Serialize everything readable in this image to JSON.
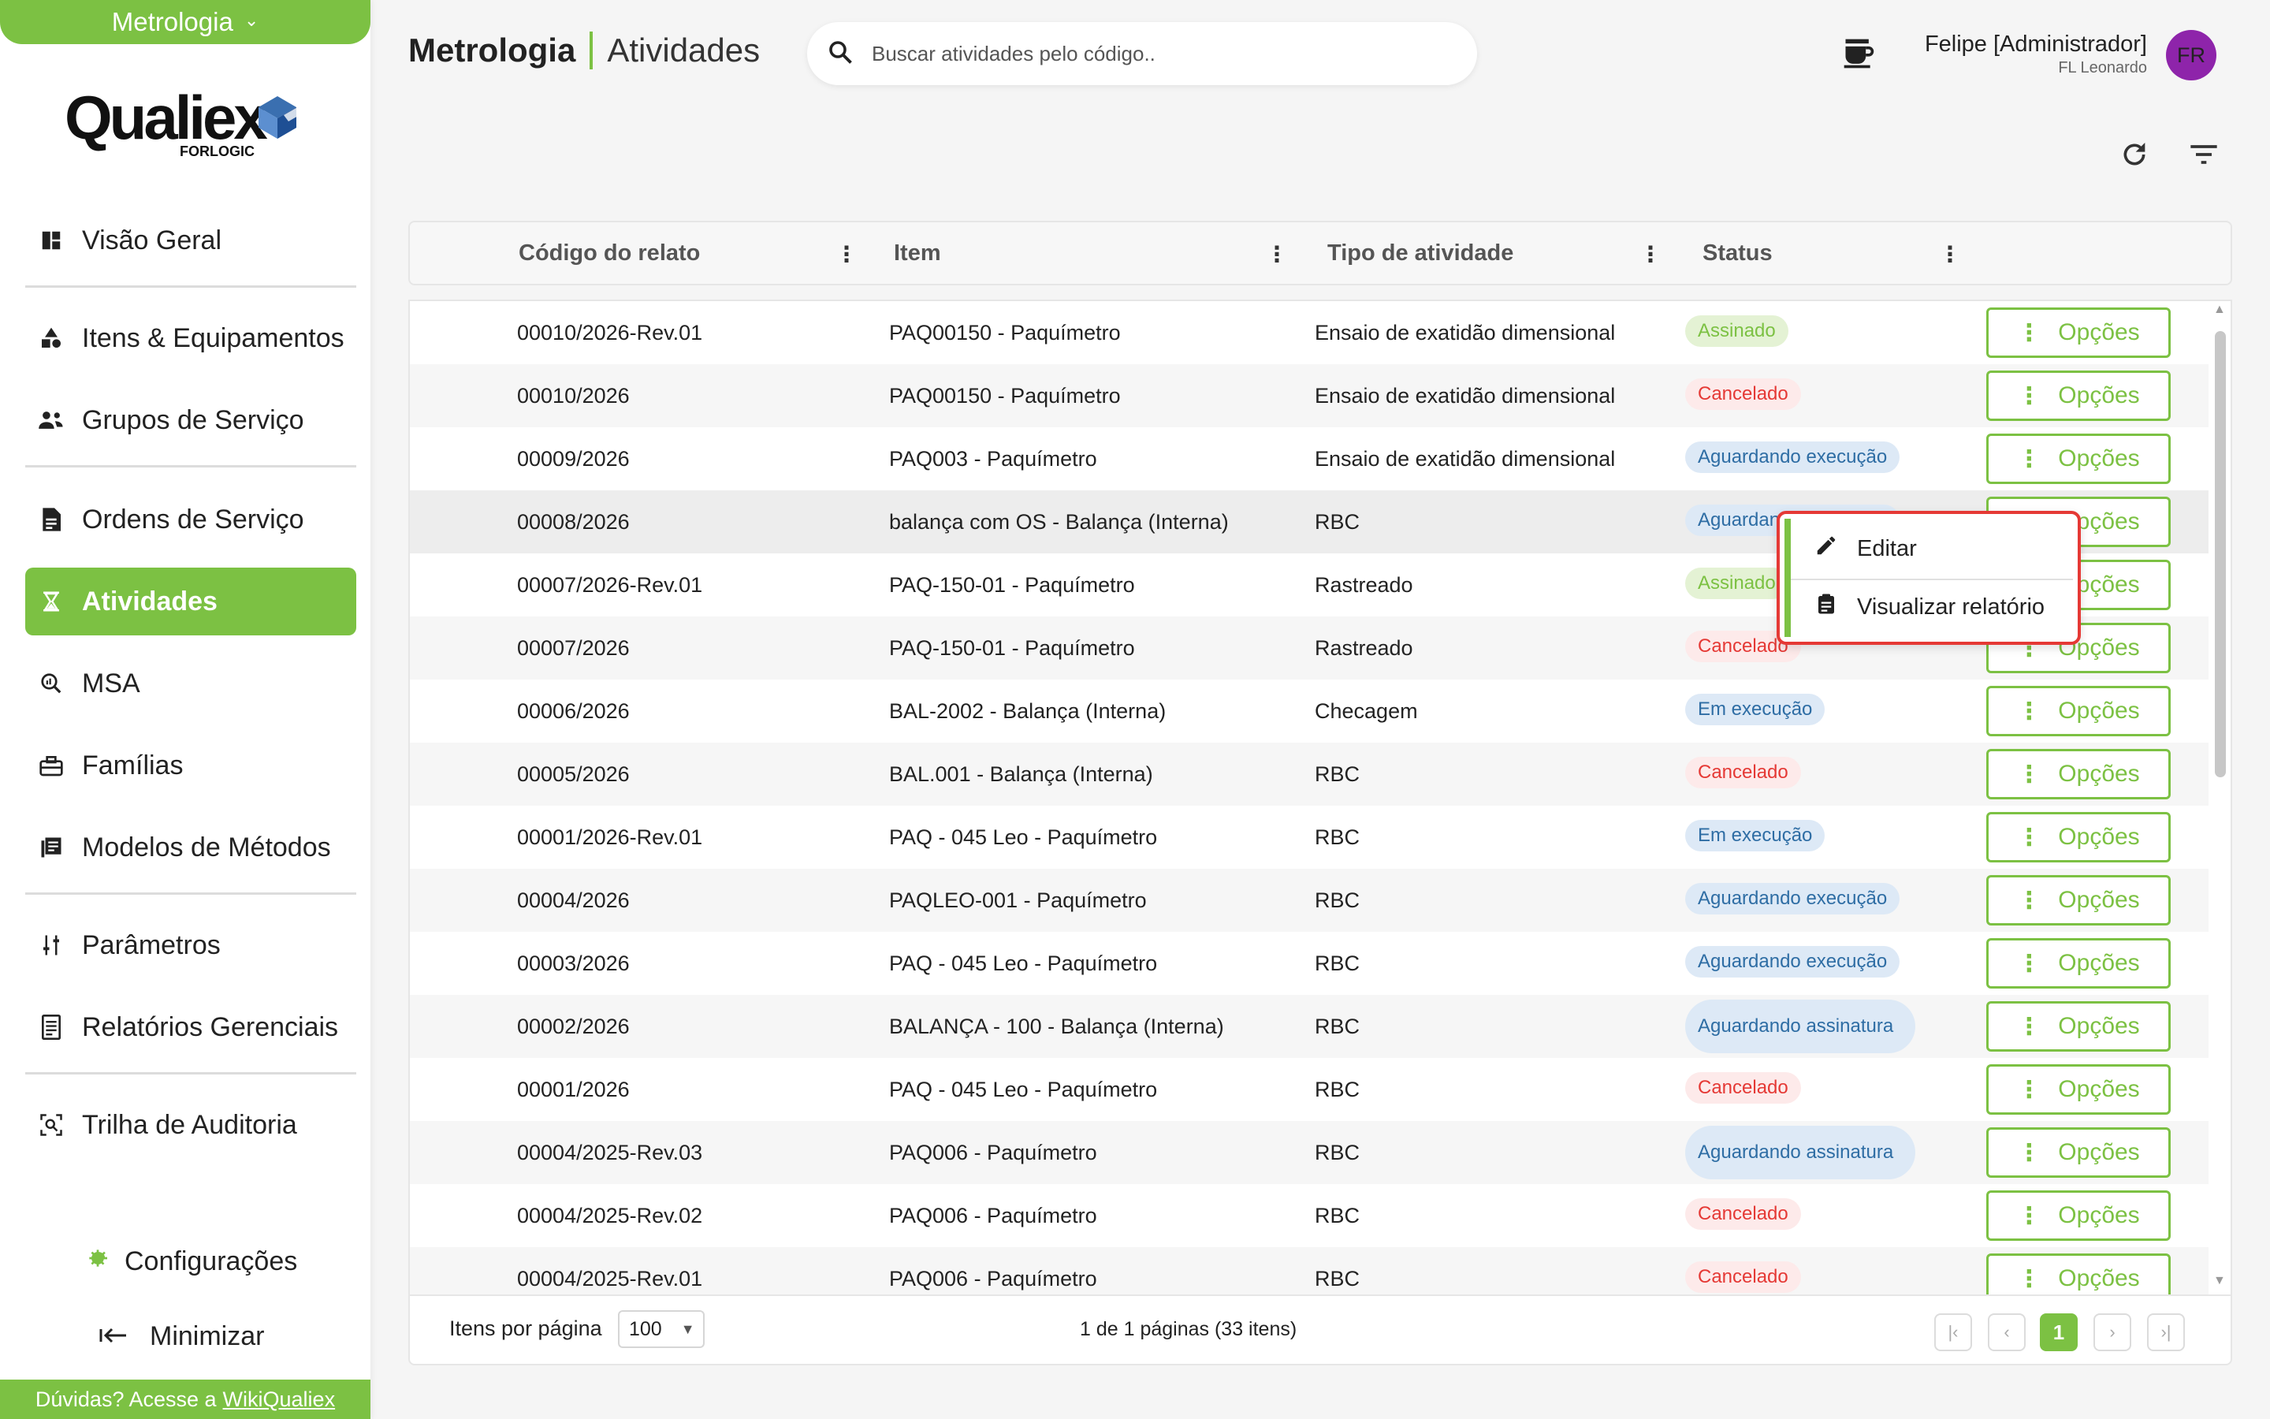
{
  "sidebar": {
    "module_label": "Metrologia",
    "logo_text": "Qualiex",
    "logo_sub": "FORLOGIC",
    "items": [
      {
        "label": "Visão Geral",
        "icon": "dashboard-icon"
      },
      {
        "label": "Itens & Equipamentos",
        "icon": "shapes-icon"
      },
      {
        "label": "Grupos de Serviço",
        "icon": "group-icon"
      },
      {
        "label": "Ordens de Serviço",
        "icon": "document-icon"
      },
      {
        "label": "Atividades",
        "icon": "hourglass-icon"
      },
      {
        "label": "MSA",
        "icon": "search-analytics-icon"
      },
      {
        "label": "Famílias",
        "icon": "toolbox-icon"
      },
      {
        "label": "Modelos de Métodos",
        "icon": "library-icon"
      },
      {
        "label": "Parâmetros",
        "icon": "sliders-icon"
      },
      {
        "label": "Relatórios Gerenciais",
        "icon": "report-icon"
      },
      {
        "label": "Trilha de Auditoria",
        "icon": "audit-icon"
      }
    ],
    "config_label": "Configurações",
    "minimize_label": "Minimizar",
    "help_text": "Dúvidas? Acesse a",
    "help_link": "WikiQualiex"
  },
  "header": {
    "module": "Metrologia",
    "page": "Atividades",
    "search_placeholder": "Buscar atividades pelo código..",
    "user_name": "Felipe [Administrador]",
    "user_sub": "FL Leonardo",
    "avatar": "FR"
  },
  "table": {
    "columns": [
      "Código do relato",
      "Item",
      "Tipo de atividade",
      "Status"
    ],
    "option_label": "Opções",
    "rows": [
      {
        "code": "00010/2026-Rev.01",
        "item": "PAQ00150 - Paquímetro",
        "type": "Ensaio de exatidão dimensional",
        "status": "Assinado",
        "st": "ok"
      },
      {
        "code": "00010/2026",
        "item": "PAQ00150 - Paquímetro",
        "type": "Ensaio de exatidão dimensional",
        "status": "Cancelado",
        "st": "cancel"
      },
      {
        "code": "00009/2026",
        "item": "PAQ003 - Paquímetro",
        "type": "Ensaio de exatidão dimensional",
        "status": "Aguardando execução",
        "st": "info"
      },
      {
        "code": "00008/2026",
        "item": "balança com OS - Balança (Interna)",
        "type": "RBC",
        "status": "Aguardando execução",
        "st": "info"
      },
      {
        "code": "00007/2026-Rev.01",
        "item": "PAQ-150-01 - Paquímetro",
        "type": "Rastreado",
        "status": "Assinado",
        "st": "ok"
      },
      {
        "code": "00007/2026",
        "item": "PAQ-150-01 - Paquímetro",
        "type": "Rastreado",
        "status": "Cancelado",
        "st": "cancel"
      },
      {
        "code": "00006/2026",
        "item": "BAL-2002 - Balança (Interna)",
        "type": "Checagem",
        "status": "Em execução",
        "st": "info"
      },
      {
        "code": "00005/2026",
        "item": "BAL.001 - Balança (Interna)",
        "type": "RBC",
        "status": "Cancelado",
        "st": "cancel"
      },
      {
        "code": "00001/2026-Rev.01",
        "item": "PAQ - 045 Leo - Paquímetro",
        "type": "RBC",
        "status": "Em execução",
        "st": "info"
      },
      {
        "code": "00004/2026",
        "item": "PAQLEO-001 - Paquímetro",
        "type": "RBC",
        "status": "Aguardando execução",
        "st": "info"
      },
      {
        "code": "00003/2026",
        "item": "PAQ - 045 Leo - Paquímetro",
        "type": "RBC",
        "status": "Aguardando execução",
        "st": "info"
      },
      {
        "code": "00002/2026",
        "item": "BALANÇA - 100 - Balança (Interna)",
        "type": "RBC",
        "status": "Aguardando assinatura",
        "st": "info2"
      },
      {
        "code": "00001/2026",
        "item": "PAQ - 045 Leo - Paquímetro",
        "type": "RBC",
        "status": "Cancelado",
        "st": "cancel"
      },
      {
        "code": "00004/2025-Rev.03",
        "item": "PAQ006 - Paquímetro",
        "type": "RBC",
        "status": "Aguardando assinatura",
        "st": "info2"
      },
      {
        "code": "00004/2025-Rev.02",
        "item": "PAQ006 - Paquímetro",
        "type": "RBC",
        "status": "Cancelado",
        "st": "cancel"
      },
      {
        "code": "00004/2025-Rev.01",
        "item": "PAQ006 - Paquímetro",
        "type": "RBC",
        "status": "Cancelado",
        "st": "cancel"
      }
    ]
  },
  "menu": {
    "edit": "Editar",
    "view_report": "Visualizar relatório"
  },
  "footer": {
    "items_per_page_label": "Itens por página",
    "items_per_page": "100",
    "page_info": "1 de 1 páginas (33 itens)",
    "current_page": "1"
  },
  "colors": {
    "accent": "#7cc143",
    "ok_bg": "#e4f2d4",
    "ok_fg": "#7cc143",
    "cancel_bg": "#fdeaea",
    "cancel_fg": "#e53935",
    "info_bg": "#dde9f6",
    "info_fg": "#2e6da4",
    "highlight": "#e53935"
  }
}
